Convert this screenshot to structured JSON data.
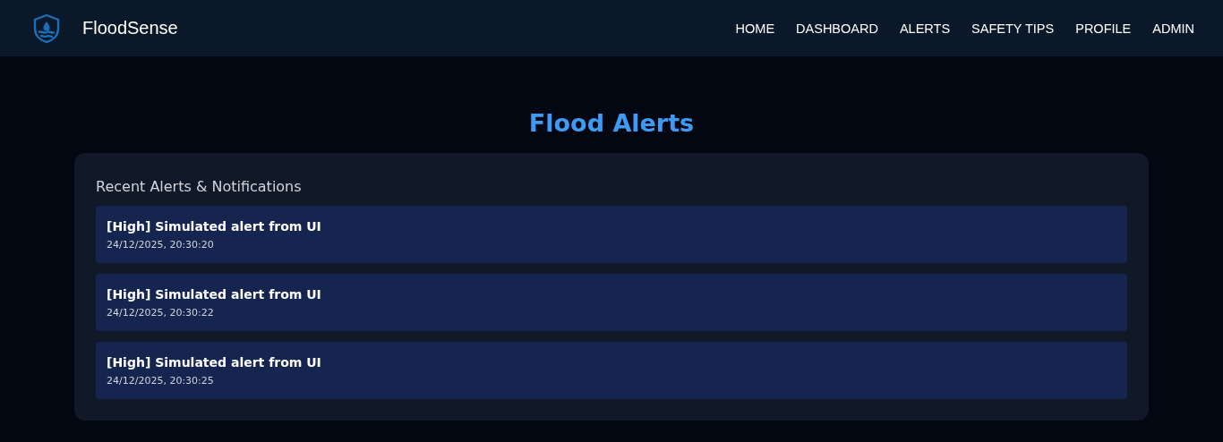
{
  "brand": {
    "name": "FloodSense"
  },
  "nav": [
    "HOME",
    "DASHBOARD",
    "ALERTS",
    "SAFETY TIPS",
    "PROFILE",
    "ADMIN"
  ],
  "page_title": "Flood Alerts",
  "panel": {
    "heading": "Recent Alerts & Notifications",
    "alerts": [
      {
        "title": "[High] Simulated alert from UI",
        "time": "24/12/2025, 20:30:20"
      },
      {
        "title": "[High] Simulated alert from UI",
        "time": "24/12/2025, 20:30:22"
      },
      {
        "title": "[High] Simulated alert from UI",
        "time": "24/12/2025, 20:30:25"
      }
    ]
  }
}
